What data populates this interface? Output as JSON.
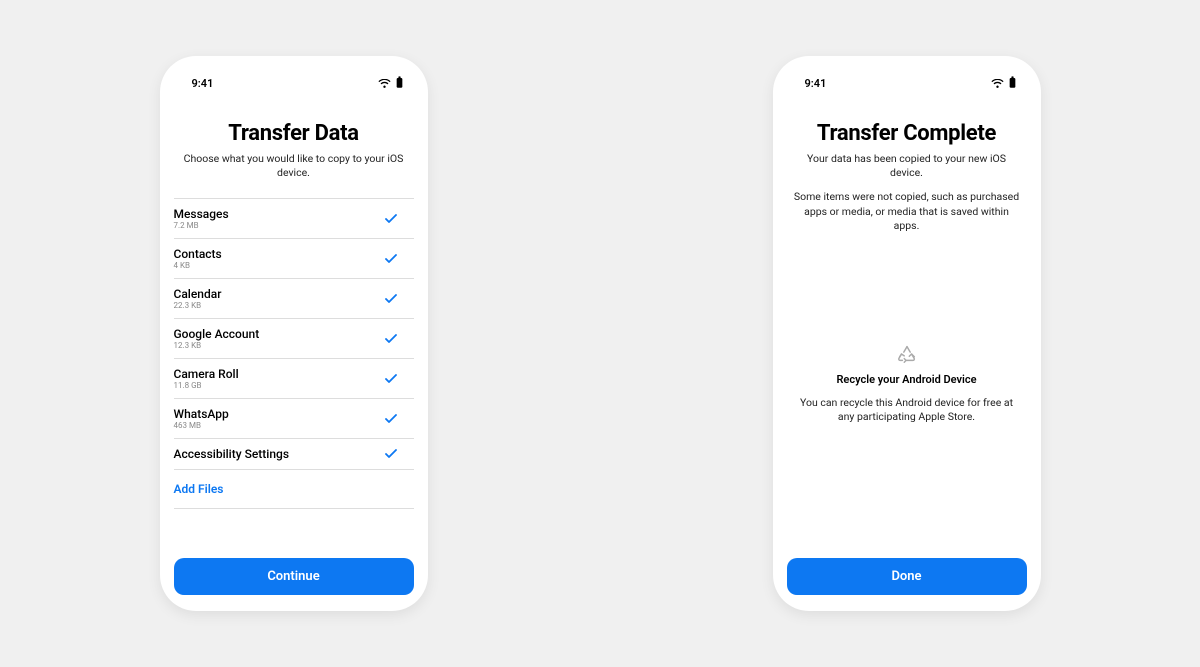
{
  "statusbar": {
    "time": "9:41"
  },
  "screen1": {
    "title": "Transfer Data",
    "subtitle": "Choose what you would like to copy to your iOS device.",
    "items": [
      {
        "label": "Messages",
        "size": "7.2 MB"
      },
      {
        "label": "Contacts",
        "size": "4 KB"
      },
      {
        "label": "Calendar",
        "size": "22.3 KB"
      },
      {
        "label": "Google Account",
        "size": "12.3 KB"
      },
      {
        "label": "Camera Roll",
        "size": "11.8 GB"
      },
      {
        "label": "WhatsApp",
        "size": "463 MB"
      },
      {
        "label": "Accessibility Settings",
        "size": ""
      }
    ],
    "add_files": "Add Files",
    "continue": "Continue"
  },
  "screen2": {
    "title": "Transfer Complete",
    "subtitle": "Your data has been copied to your new iOS device.",
    "subtitle2": "Some items were not copied, such as purchased apps or media, or media that is saved within apps.",
    "recycle_title": "Recycle your Android Device",
    "recycle_text": "You can recycle this Android device for free at any participating Apple Store.",
    "done": "Done"
  }
}
